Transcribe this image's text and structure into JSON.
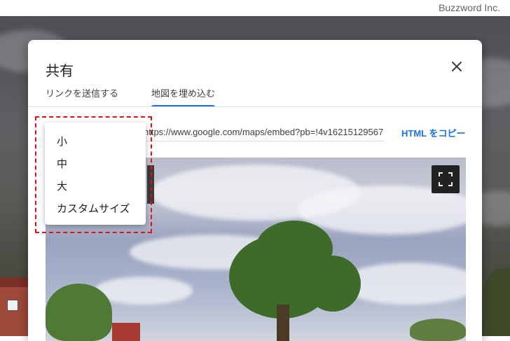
{
  "watermark": "Buzzword Inc.",
  "dialog": {
    "title": "共有",
    "tabs": [
      {
        "label": "リンクを送信する",
        "active": false
      },
      {
        "label": "地図を埋め込む",
        "active": true
      }
    ],
    "embed_code": "https://www.google.com/maps/embed?pb=!4v16215129567",
    "copy_label": "HTML をコピー"
  },
  "size_menu": {
    "options": [
      "小",
      "中",
      "大",
      "カスタムサイズ"
    ]
  },
  "colors": {
    "accent": "#1a73e8",
    "highlight": "#e0101a"
  }
}
